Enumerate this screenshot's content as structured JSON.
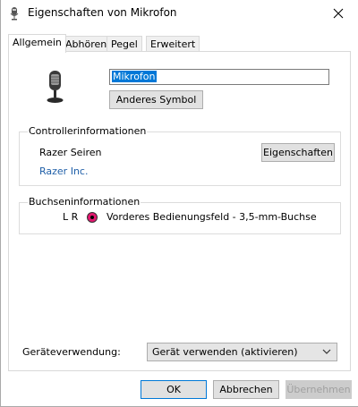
{
  "window": {
    "title": "Eigenschaften von Mikrofon"
  },
  "tabs": [
    {
      "label": "Allgemein",
      "active": true
    },
    {
      "label": "Abhören",
      "active": false
    },
    {
      "label": "Pegel",
      "active": false
    },
    {
      "label": "Erweitert",
      "active": false
    }
  ],
  "general": {
    "device_name": "Mikrofon",
    "change_icon_button": "Anderes Symbol"
  },
  "controller": {
    "group_label": "Controllerinformationen",
    "name": "Razer Seiren",
    "vendor": "Razer Inc.",
    "properties_button": "Eigenschaften"
  },
  "jack": {
    "group_label": "Buchseninformationen",
    "channels": "L R",
    "color": "#e2176f",
    "description": "Vorderes Bedienungsfeld - 3,5-mm-Buchse"
  },
  "usage": {
    "label": "Geräteverwendung:",
    "selected": "Gerät verwenden (aktivieren)"
  },
  "buttons": {
    "ok": "OK",
    "cancel": "Abbrechen",
    "apply": "Übernehmen"
  },
  "icons": {
    "title_icon": "microphone-icon",
    "device_icon": "microphone-icon",
    "close_icon": "close-icon",
    "dropdown_icon": "chevron-down-icon"
  }
}
